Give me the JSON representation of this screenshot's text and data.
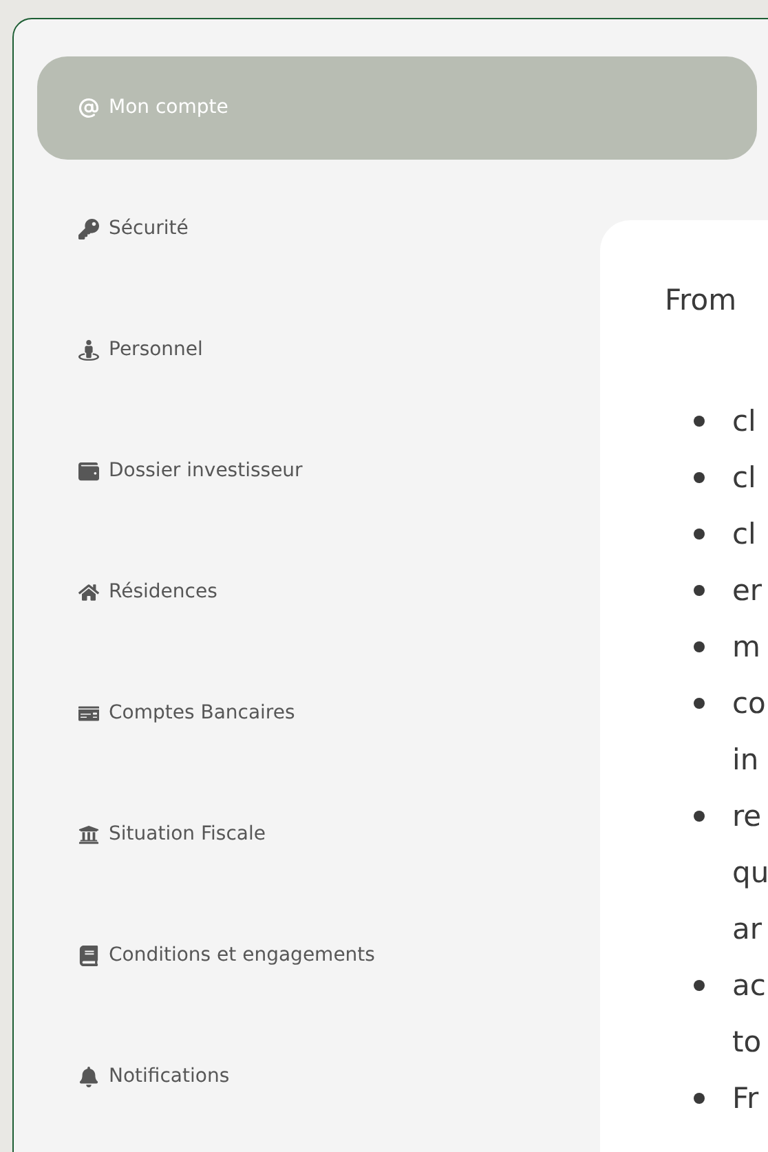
{
  "sidebar": {
    "items": [
      {
        "label": "Mon compte",
        "selected": true
      },
      {
        "label": "Sécurité",
        "selected": false
      },
      {
        "label": "Personnel",
        "selected": false
      },
      {
        "label": "Dossier investisseur",
        "selected": false
      },
      {
        "label": "Résidences",
        "selected": false
      },
      {
        "label": "Comptes Bancaires",
        "selected": false
      },
      {
        "label": "Situation Fiscale",
        "selected": false
      },
      {
        "label": "Conditions et engagements",
        "selected": false
      },
      {
        "label": "Notifications",
        "selected": false
      }
    ]
  },
  "content": {
    "intro": "From",
    "bullets": [
      {
        "lines": [
          "cl"
        ]
      },
      {
        "lines": [
          "cl"
        ]
      },
      {
        "lines": [
          "cl"
        ]
      },
      {
        "lines": [
          "er"
        ]
      },
      {
        "lines": [
          "m"
        ]
      },
      {
        "lines": [
          "co",
          "in"
        ]
      },
      {
        "lines": [
          "re",
          "qu",
          "ar"
        ]
      },
      {
        "lines": [
          "ac",
          "to"
        ]
      },
      {
        "lines": [
          "Fr"
        ]
      }
    ]
  }
}
